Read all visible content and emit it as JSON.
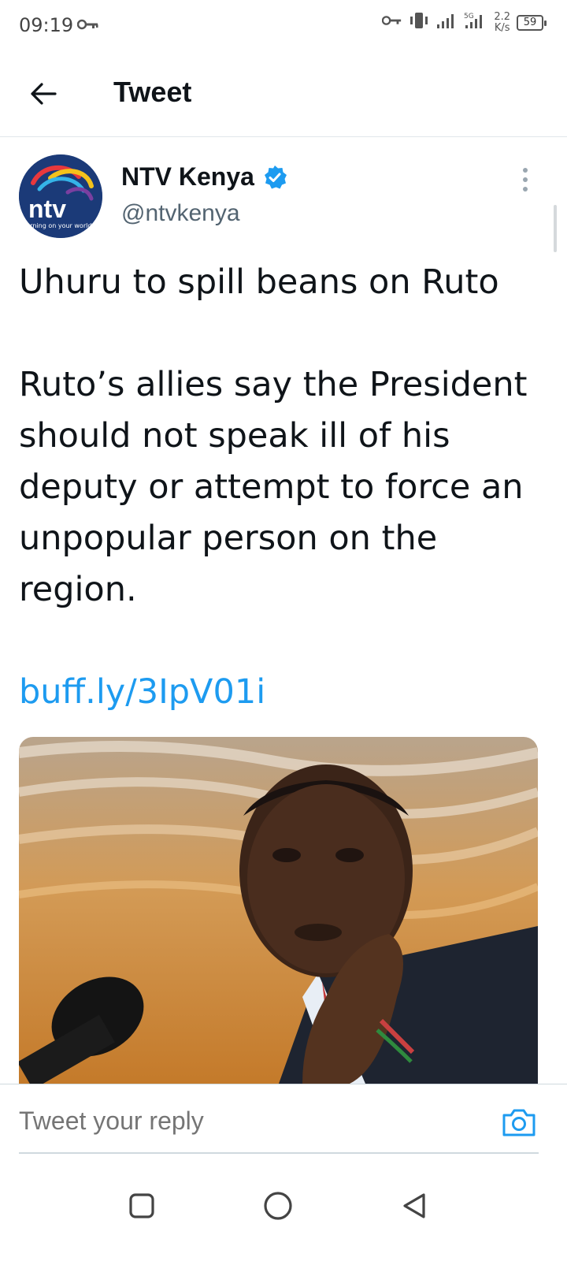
{
  "status_bar": {
    "time": "09:19",
    "network_speed_value": "2.2",
    "network_speed_unit": "K/s",
    "battery_level": "59",
    "icons": [
      "key-icon",
      "vibrate-icon",
      "signal-icon",
      "signal-5g-icon",
      "battery-icon"
    ]
  },
  "header": {
    "title": "Tweet",
    "back_icon": "arrow-left-icon"
  },
  "tweet": {
    "author_name": "NTV Kenya",
    "verified": true,
    "handle": "@ntvkenya",
    "avatar_logo_text": "ntv",
    "avatar_tagline": "turning on your world",
    "headline": "Uhuru to spill beans on Ruto",
    "body": "Ruto’s allies say the President should not speak ill of his deputy or attempt to force an unpopular person on the region.",
    "link": "buff.ly/3IpV01i"
  },
  "reply": {
    "placeholder": "Tweet your reply",
    "camera_icon": "camera-icon"
  },
  "colors": {
    "link": "#1d9bf0",
    "verified": "#1d9bf0",
    "text": "#0f1419",
    "secondary": "#536471"
  }
}
